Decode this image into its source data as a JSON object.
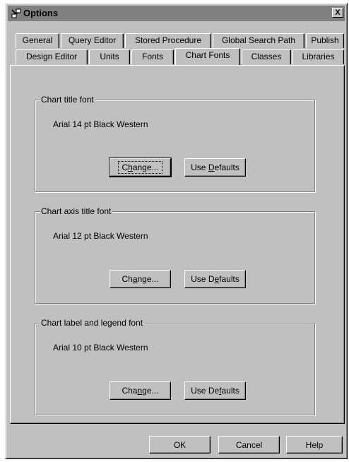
{
  "window": {
    "title": "Options",
    "close_glyph": "X",
    "icon": "options-app-icon"
  },
  "tabs_row1": [
    {
      "label": "General"
    },
    {
      "label": "Query Editor"
    },
    {
      "label": "Stored Procedure"
    },
    {
      "label": "Global Search Path"
    },
    {
      "label": "Publish"
    }
  ],
  "tabs_row2": [
    {
      "label": "Design Editor"
    },
    {
      "label": "Units"
    },
    {
      "label": "Fonts"
    },
    {
      "label": "Chart Fonts",
      "active": true
    },
    {
      "label": "Classes"
    },
    {
      "label": "Libraries"
    }
  ],
  "groups": [
    {
      "title": "Chart title font",
      "font_desc": "Arial 14 pt Black Western",
      "change_pre": "C",
      "change_key": "h",
      "change_post": "ange...",
      "defaults_pre": "Use ",
      "defaults_key": "D",
      "defaults_post": "efaults"
    },
    {
      "title": "Chart axis title font",
      "font_desc": "Arial 12 pt Black Western",
      "change_pre": "Ch",
      "change_key": "a",
      "change_post": "nge...",
      "defaults_pre": "Use D",
      "defaults_key": "e",
      "defaults_post": "faults"
    },
    {
      "title": "Chart label and legend font",
      "font_desc": "Arial 10 pt Black Western",
      "change_pre": "Cha",
      "change_key": "n",
      "change_post": "ge...",
      "defaults_pre": "Use De",
      "defaults_key": "f",
      "defaults_post": "aults"
    }
  ],
  "footer": {
    "ok_label": "OK",
    "cancel_label": "Cancel",
    "help_label": "Help"
  }
}
